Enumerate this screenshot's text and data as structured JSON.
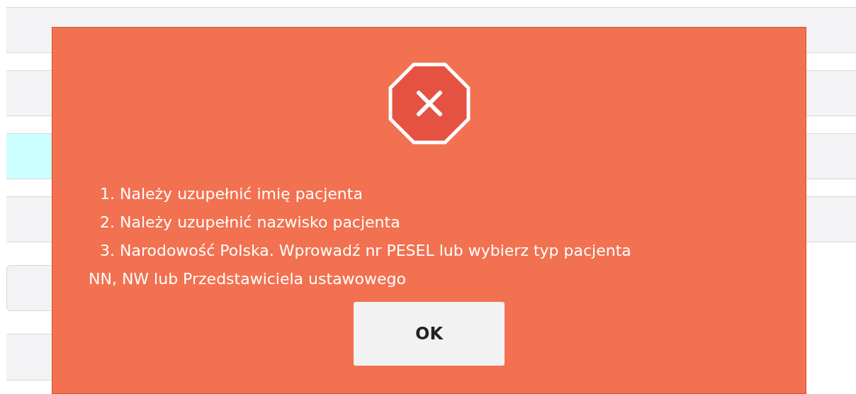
{
  "background_rows": [
    {
      "kind": "row",
      "selected": false
    },
    {
      "kind": "row",
      "selected": false
    },
    {
      "kind": "row",
      "selected": true
    },
    {
      "kind": "row",
      "selected": false
    },
    {
      "kind": "field"
    },
    {
      "kind": "block"
    }
  ],
  "dialog": {
    "kind": "error",
    "messages": [
      "1. Należy uzupełnić imię pacjenta",
      "2. Należy uzupełnić nazwisko pacjenta",
      "3. Narodowość Polska. Wprowadź nr PESEL lub wybierz typ pacjenta NN, NW lub Przedstawiciela ustawowego"
    ],
    "button": "OK"
  }
}
